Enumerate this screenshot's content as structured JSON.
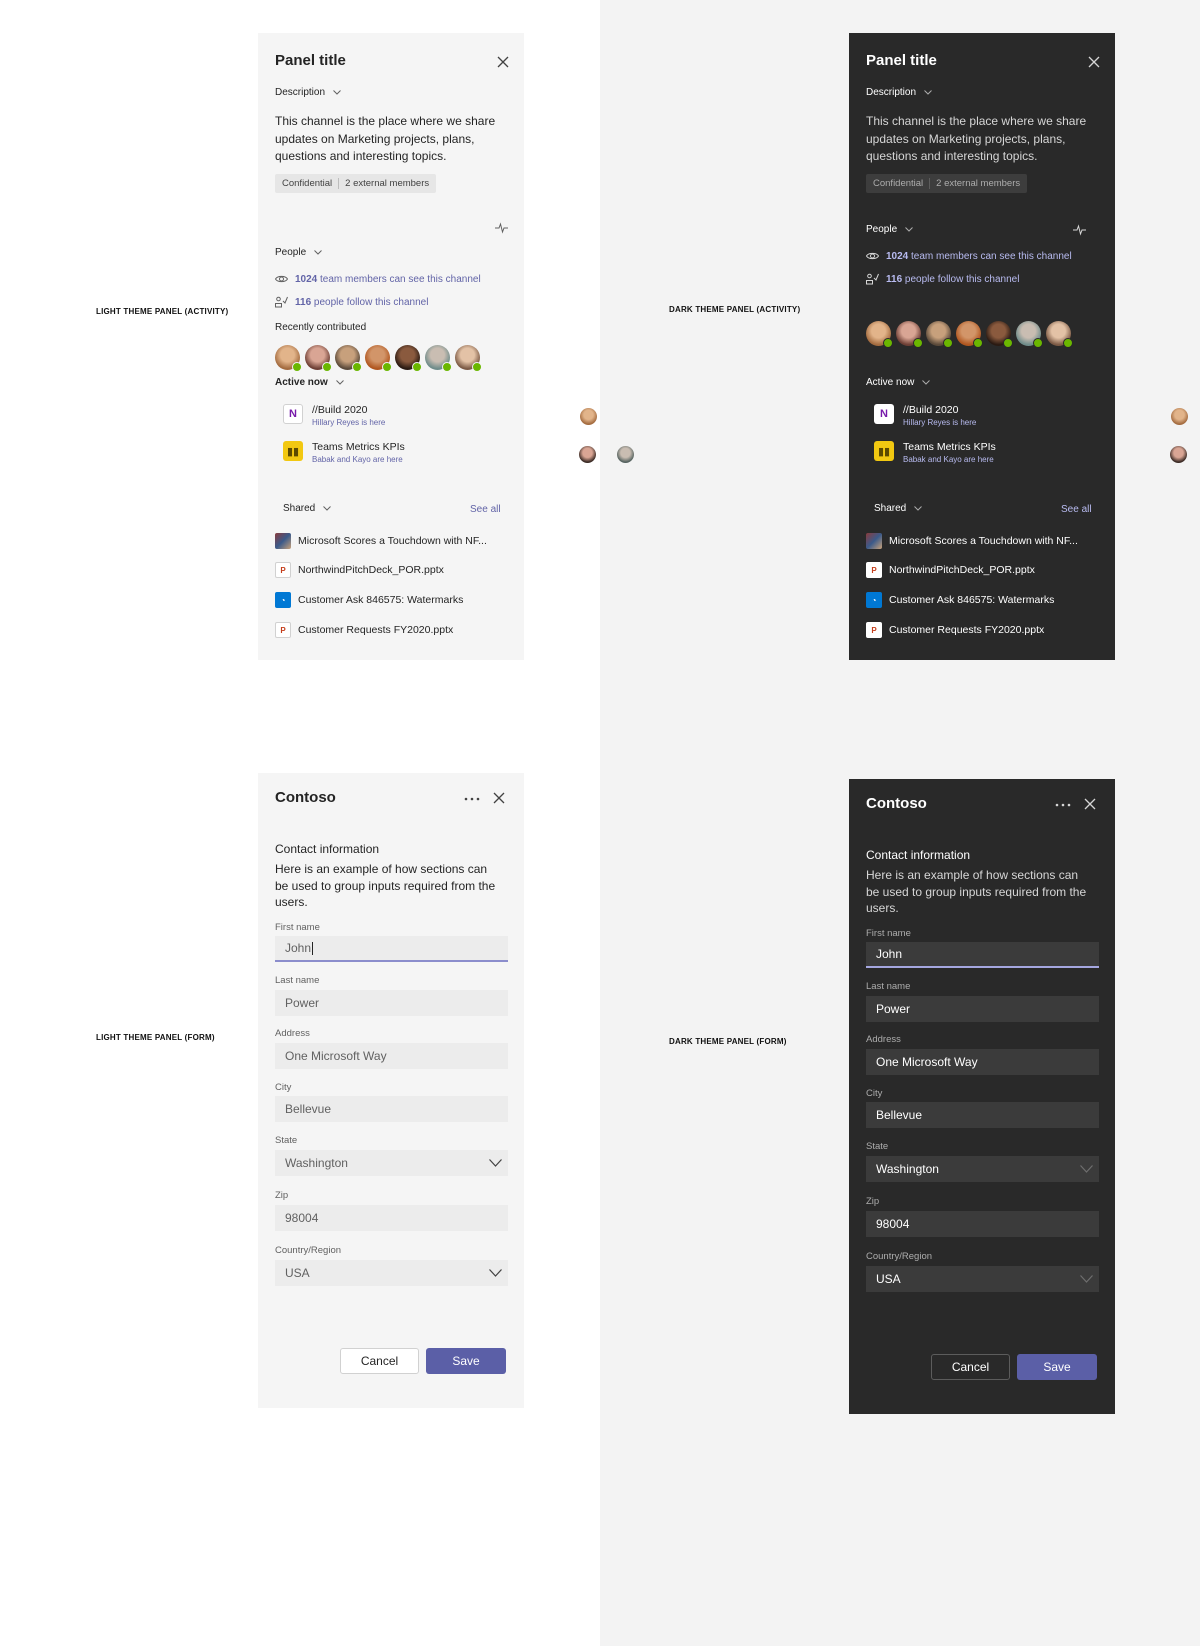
{
  "captions": {
    "light_activity": "LIGHT THEME PANEL (ACTIVITY)",
    "dark_activity": "DARK THEME PANEL (ACTIVITY)",
    "light_form": "LIGHT THEME PANEL (FORM)",
    "dark_form": "DARK THEME PANEL (FORM)"
  },
  "activity": {
    "title": "Panel title",
    "description_header": "Description",
    "description": "This channel is the place where we share updates on Marketing projects, plans, questions and interesting topics.",
    "tags": [
      "Confidential",
      "2 external members"
    ],
    "people_header": "People",
    "members_count": "1024",
    "members_text": "team members can see this channel",
    "followers_count": "116",
    "followers_text": "people follow this channel",
    "recently_contributed": "Recently contributed",
    "active_now_header": "Active now",
    "active_items": [
      {
        "name": "//Build 2020",
        "sub": "Hillary Reyes is here",
        "icon": "onenote-icon"
      },
      {
        "name": "Teams Metrics KPIs",
        "sub": "Babak and Kayo are here",
        "icon": "powerbi-icon"
      }
    ],
    "shared_header": "Shared",
    "see_all": "See all",
    "files": [
      {
        "name": "Microsoft Scores a Touchdown with NF...",
        "icon": "image-thumbnail-icon"
      },
      {
        "name": "NorthwindPitchDeck_POR.pptx",
        "icon": "powerpoint-icon"
      },
      {
        "name": "Customer Ask 846575: Watermarks",
        "icon": "azure-devops-icon"
      },
      {
        "name": "Customer Requests FY2020.pptx",
        "icon": "powerpoint-icon"
      }
    ]
  },
  "form": {
    "title": "Contoso",
    "section_title": "Contact information",
    "section_desc": "Here is an example of how sections can be used to group inputs required from the users.",
    "fields": [
      {
        "label": "First name",
        "value": "John"
      },
      {
        "label": "Last name",
        "value": "Power"
      },
      {
        "label": "Address",
        "value": "One Microsoft Way"
      },
      {
        "label": "City",
        "value": "Bellevue"
      },
      {
        "label": "State",
        "value": "Washington"
      },
      {
        "label": "Zip",
        "value": "98004"
      },
      {
        "label": "Country/Region",
        "value": "USA"
      }
    ],
    "cancel": "Cancel",
    "save": "Save"
  },
  "colors": {
    "brand": "#5b5fa7",
    "link_light": "#6264a7",
    "link_dark": "#b8bbf0",
    "presence_available": "#6bb700"
  }
}
